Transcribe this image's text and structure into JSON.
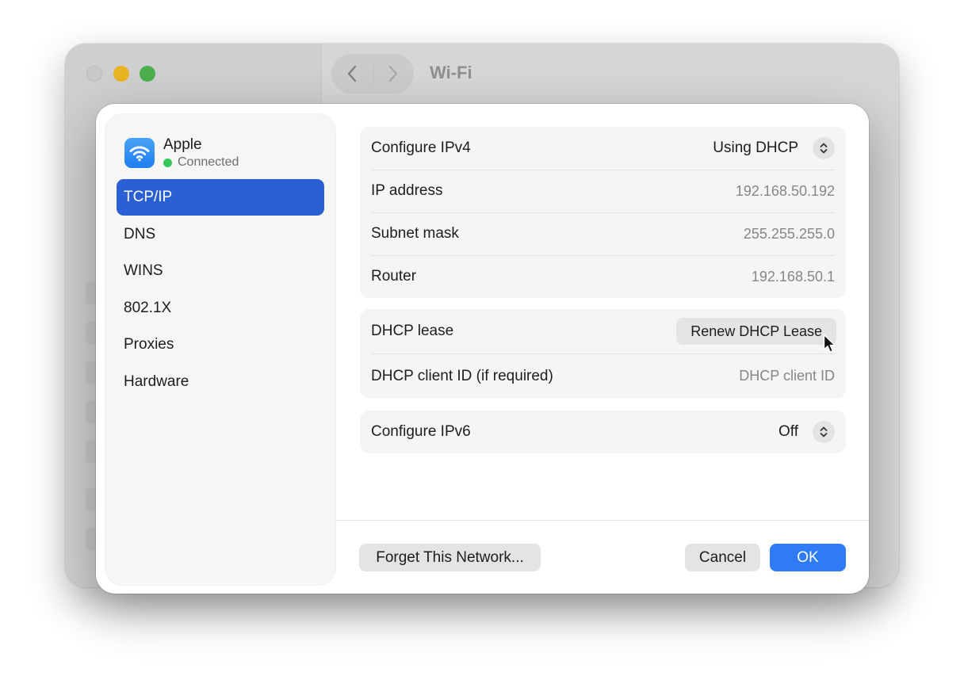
{
  "background_window": {
    "title": "Wi-Fi",
    "nav_back_glyph": "‹",
    "nav_forward_glyph": "›"
  },
  "network": {
    "name": "Apple",
    "status": "Connected",
    "icon": "wifi-icon",
    "status_color": "#34c759"
  },
  "sidebar": {
    "items": [
      {
        "label": "TCP/IP",
        "selected": true
      },
      {
        "label": "DNS",
        "selected": false
      },
      {
        "label": "WINS",
        "selected": false
      },
      {
        "label": "802.1X",
        "selected": false
      },
      {
        "label": "Proxies",
        "selected": false
      },
      {
        "label": "Hardware",
        "selected": false
      }
    ]
  },
  "ipv4": {
    "configure_label": "Configure IPv4",
    "configure_value": "Using DHCP",
    "ip_label": "IP address",
    "ip_value": "192.168.50.192",
    "subnet_label": "Subnet mask",
    "subnet_value": "255.255.255.0",
    "router_label": "Router",
    "router_value": "192.168.50.1"
  },
  "dhcp": {
    "lease_label": "DHCP lease",
    "renew_button": "Renew DHCP Lease",
    "client_id_label": "DHCP client ID (if required)",
    "client_id_placeholder": "DHCP client ID"
  },
  "ipv6": {
    "configure_label": "Configure IPv6",
    "configure_value": "Off"
  },
  "footer": {
    "forget_button": "Forget This Network...",
    "cancel_button": "Cancel",
    "ok_button": "OK"
  },
  "colors": {
    "accent": "#2f7bf6",
    "selection": "#2b5fd4"
  }
}
